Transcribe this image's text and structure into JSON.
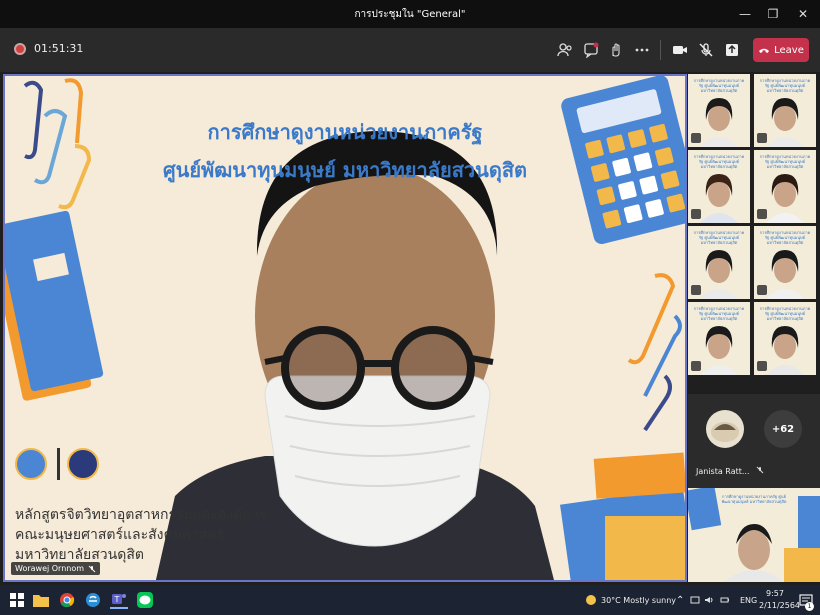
{
  "window": {
    "title": "การประชุมใน \"General\""
  },
  "toolbar": {
    "timer": "01:51:31",
    "leave_label": "Leave"
  },
  "slide": {
    "title_line1": "การศึกษาดูงานหน่วยงานภาครัฐ",
    "title_line2": "ศูนย์พัฒนาทุนมนุษย์ มหาวิทยาลัยสวนดุสิต",
    "footer_line1": "หลักสูตรจิตวิทยาอุตสาหกรรมและองค์การ",
    "footer_line2": "คณะมนุษยศาสตร์และสังคมศาสตร์",
    "footer_line3": "มหาวิทยาลัยสวนดุสิต"
  },
  "speaker": {
    "name": "Worawej Ornnom"
  },
  "gallery": {
    "avatar_name": "Janista Ratt...",
    "more_count": "+62",
    "tile_caption": "การศึกษาดูงานหน่วยงานภาครัฐ ศูนย์พัฒนาทุนมนุษย์ มหาวิทยาลัยสวนดุสิต"
  },
  "taskbar": {
    "weather": "30°C  Mostly sunny",
    "lang": "ENG",
    "time": "9:57",
    "date": "2/11/2564",
    "notif_count": "1"
  },
  "colors": {
    "accent": "#6a75c8",
    "leave": "#c4314b",
    "slide_title": "#3a7ac9"
  }
}
